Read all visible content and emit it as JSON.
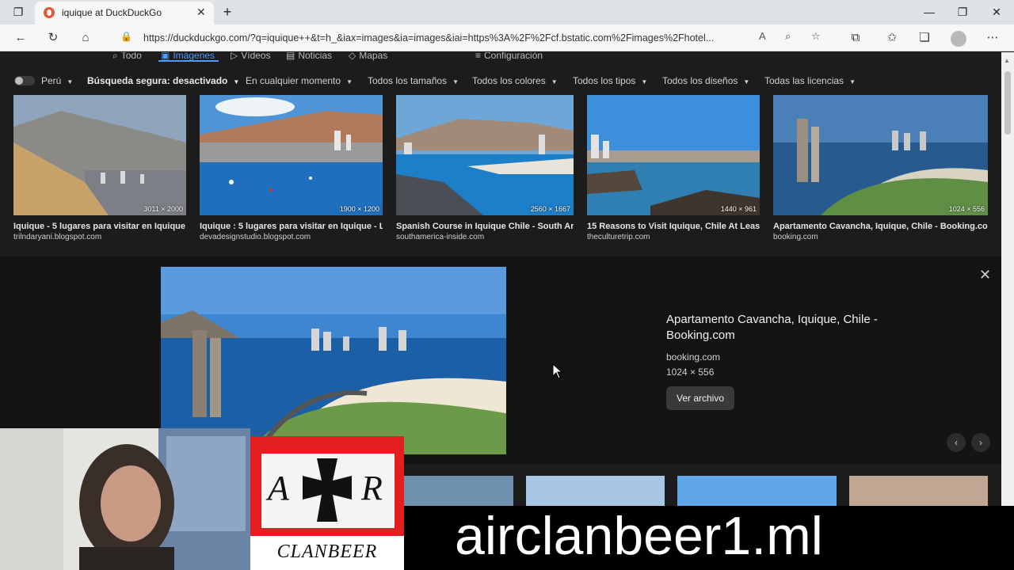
{
  "browser": {
    "tab_title": "iquique at DuckDuckGo",
    "url": "https://duckduckgo.com/?q=iquique++&t=h_&iax=images&ia=images&iai=https%3A%2F%2Fcf.bstatic.com%2Fimages%2Fhotel..."
  },
  "nav_tabs": [
    {
      "label": "Todo",
      "icon": "search-icon"
    },
    {
      "label": "Imágenes",
      "icon": "image-icon"
    },
    {
      "label": "Vídeos",
      "icon": "play-icon"
    },
    {
      "label": "Noticias",
      "icon": "news-icon"
    },
    {
      "label": "Mapas",
      "icon": "map-pin-icon"
    },
    {
      "label": "Configuración",
      "icon": "sliders-icon"
    }
  ],
  "filters": {
    "region": "Perú",
    "safe_search": "Búsqueda segura: desactivado",
    "time": "En cualquier momento",
    "size": "Todos los tamaños",
    "color": "Todos los colores",
    "type": "Todos los tipos",
    "layout": "Todos los diseños",
    "license": "Todas las licencias"
  },
  "results": [
    {
      "title": "Iquique - 5 lugares para visitar en Iquique ...",
      "source": "trilndaryani.blogspot.com",
      "dims": "3011 × 2000"
    },
    {
      "title": "Iquique : 5 lugares para visitar en Iquique - L...",
      "source": "devadesignstudio.blogspot.com",
      "dims": "1900 × 1200"
    },
    {
      "title": "Spanish Course in Iquique Chile - South Am...",
      "source": "southamerica-inside.com",
      "dims": "2560 × 1667"
    },
    {
      "title": "15 Reasons to Visit Iquique, Chile At Least ...",
      "source": "theculturetrip.com",
      "dims": "1440 × 961"
    },
    {
      "title": "Apartamento Cavancha, Iquique, Chile - Booking.com",
      "source": "booking.com",
      "dims": "1024 × 556"
    }
  ],
  "detail": {
    "title": "Apartamento Cavancha, Iquique, Chile - Booking.com",
    "source": "booking.com",
    "dims": "1024 × 556",
    "button": "Ver archivo"
  },
  "overlay": {
    "logo_left": "A",
    "logo_right": "R",
    "logo_text": "CLANBEER",
    "banner": "airclanbeer1.ml"
  }
}
